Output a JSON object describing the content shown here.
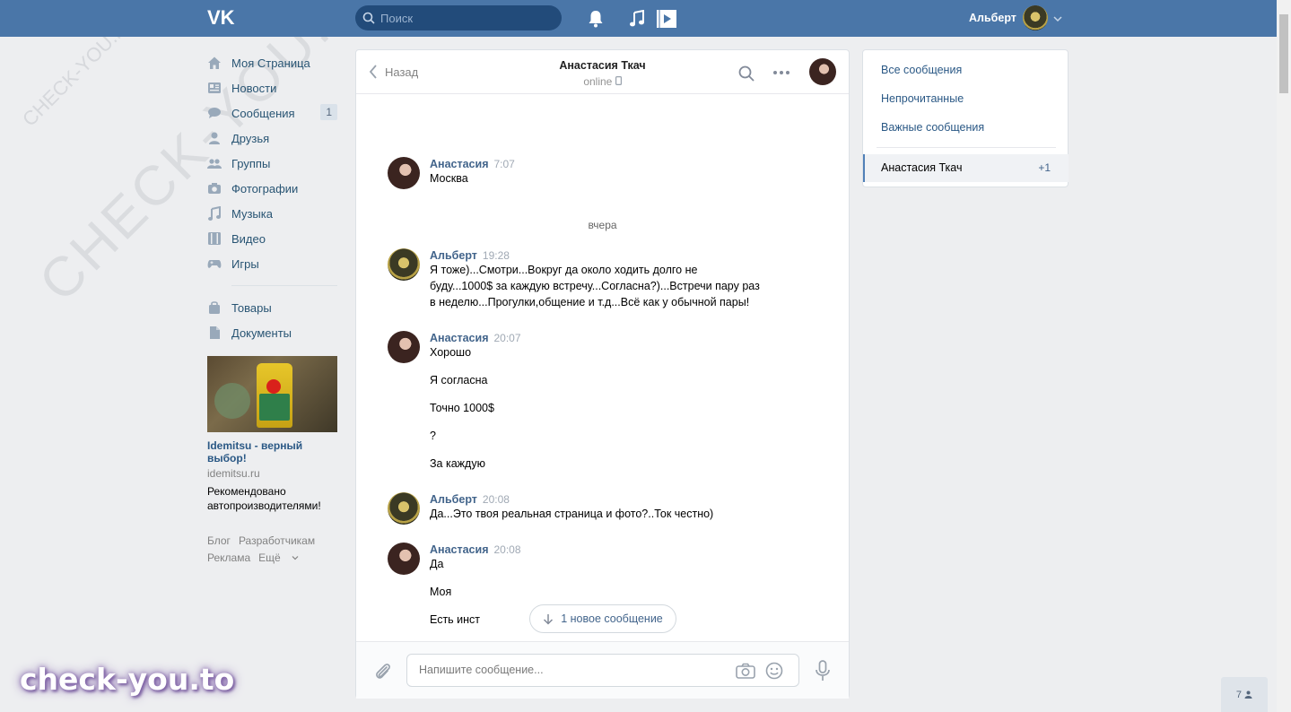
{
  "header": {
    "search_placeholder": "Поиск",
    "user_name": "Альберт"
  },
  "nav": {
    "items": [
      {
        "label": "Моя Страница",
        "icon": "home-icon"
      },
      {
        "label": "Новости",
        "icon": "news-icon"
      },
      {
        "label": "Сообщения",
        "icon": "messages-icon",
        "count": "1"
      },
      {
        "label": "Друзья",
        "icon": "person-icon"
      },
      {
        "label": "Группы",
        "icon": "groups-icon"
      },
      {
        "label": "Фотографии",
        "icon": "camera-icon"
      },
      {
        "label": "Музыка",
        "icon": "music-icon"
      },
      {
        "label": "Видео",
        "icon": "video-icon"
      },
      {
        "label": "Игры",
        "icon": "gamepad-icon"
      }
    ],
    "items2": [
      {
        "label": "Товары",
        "icon": "shopping-bag-icon"
      },
      {
        "label": "Документы",
        "icon": "document-icon"
      }
    ]
  },
  "ad": {
    "title": "Idemitsu - верный выбор!",
    "domain": "idemitsu.ru",
    "text_line1": "Рекомендовано",
    "text_line2": "автопроизводителями!"
  },
  "footer": {
    "blog": "Блог",
    "developers": "Разработчикам",
    "ads": "Реклама",
    "more": "Ещё"
  },
  "chat": {
    "back_label": "Назад",
    "title": "Анастасия Ткач",
    "status": "online",
    "day_separator": "вчера",
    "messages": [
      {
        "author": "Анастасия",
        "time": "7:07",
        "lines": [
          "Москва"
        ]
      },
      {
        "author": "Альберт",
        "time": "19:28",
        "lines": [
          "Я тоже)...Смотри...Вокруг да около ходить долго не",
          "буду...1000$ за каждую встречу...Согласна?)...Встречи пару раз",
          "в неделю...Прогулки,общение и т.д...Всё как у обычной пары!"
        ]
      },
      {
        "author": "Анастасия",
        "time": "20:07",
        "lines": [
          "Хорошо",
          "Я согласна",
          "Точно 1000$",
          "?",
          "За каждую"
        ]
      },
      {
        "author": "Альберт",
        "time": "20:08",
        "lines": [
          "Да...Это твоя реальная страница и фото?..Ток честно)"
        ]
      },
      {
        "author": "Анастасия",
        "time": "20:08",
        "lines": [
          "Да",
          "Моя",
          "Есть инст"
        ]
      }
    ],
    "new_message_pill": "1 новое сообщение",
    "composer_placeholder": "Напишите сообщение..."
  },
  "right_menu": {
    "all": "Все сообщения",
    "unread": "Непрочитанные",
    "important": "Важные сообщения",
    "active_name": "Анастасия Ткач",
    "active_count": "+1"
  },
  "watermark": {
    "text": "CHECK-YOU.ME",
    "brand": "check-you.to"
  },
  "online_counter": "7"
}
